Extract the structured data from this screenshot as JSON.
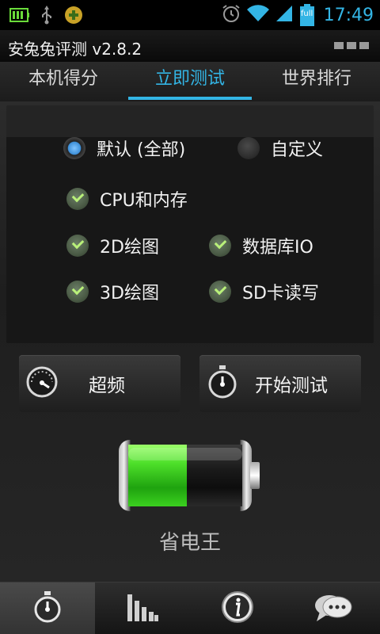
{
  "status_bar": {
    "time": "17:49",
    "battery_label": "full",
    "icons": [
      "battery-full-notification-icon",
      "usb-icon",
      "android-app-icon",
      "alarm-icon",
      "wifi-icon",
      "signal-icon",
      "battery-icon"
    ]
  },
  "app": {
    "title": "安兔兔评测 v2.8.2",
    "menu_icon": "overflow-menu-icon"
  },
  "tabs": [
    {
      "label": "本机得分",
      "active": false
    },
    {
      "label": "立即测试",
      "active": true
    },
    {
      "label": "世界排行",
      "active": false
    }
  ],
  "options": {
    "mode_default": {
      "label": "默认 (全部)",
      "selected": true
    },
    "mode_custom": {
      "label": "自定义",
      "selected": false
    },
    "tests": {
      "cpu_memory": {
        "label": "CPU和内存",
        "checked": true
      },
      "graphics_2d": {
        "label": "2D绘图",
        "checked": true
      },
      "database_io": {
        "label": "数据库IO",
        "checked": true
      },
      "graphics_3d": {
        "label": "3D绘图",
        "checked": true
      },
      "sd_rw": {
        "label": "SD卡读写",
        "checked": true
      }
    }
  },
  "buttons": {
    "overclock": {
      "label": "超频",
      "icon": "speedometer-icon"
    },
    "start_test": {
      "label": "开始测试",
      "icon": "stopwatch-icon"
    }
  },
  "power_saver": {
    "label": "省电王",
    "battery_level": 0.5,
    "fill_color": "#4ee02a"
  },
  "bottom_nav": [
    {
      "icon": "stopwatch-icon",
      "active": true
    },
    {
      "icon": "bar-chart-icon",
      "active": false
    },
    {
      "icon": "info-icon",
      "active": false
    },
    {
      "icon": "chat-bubble-icon",
      "active": false
    }
  ],
  "colors": {
    "accent": "#33b5e5",
    "check_green": "#b9f07a"
  }
}
